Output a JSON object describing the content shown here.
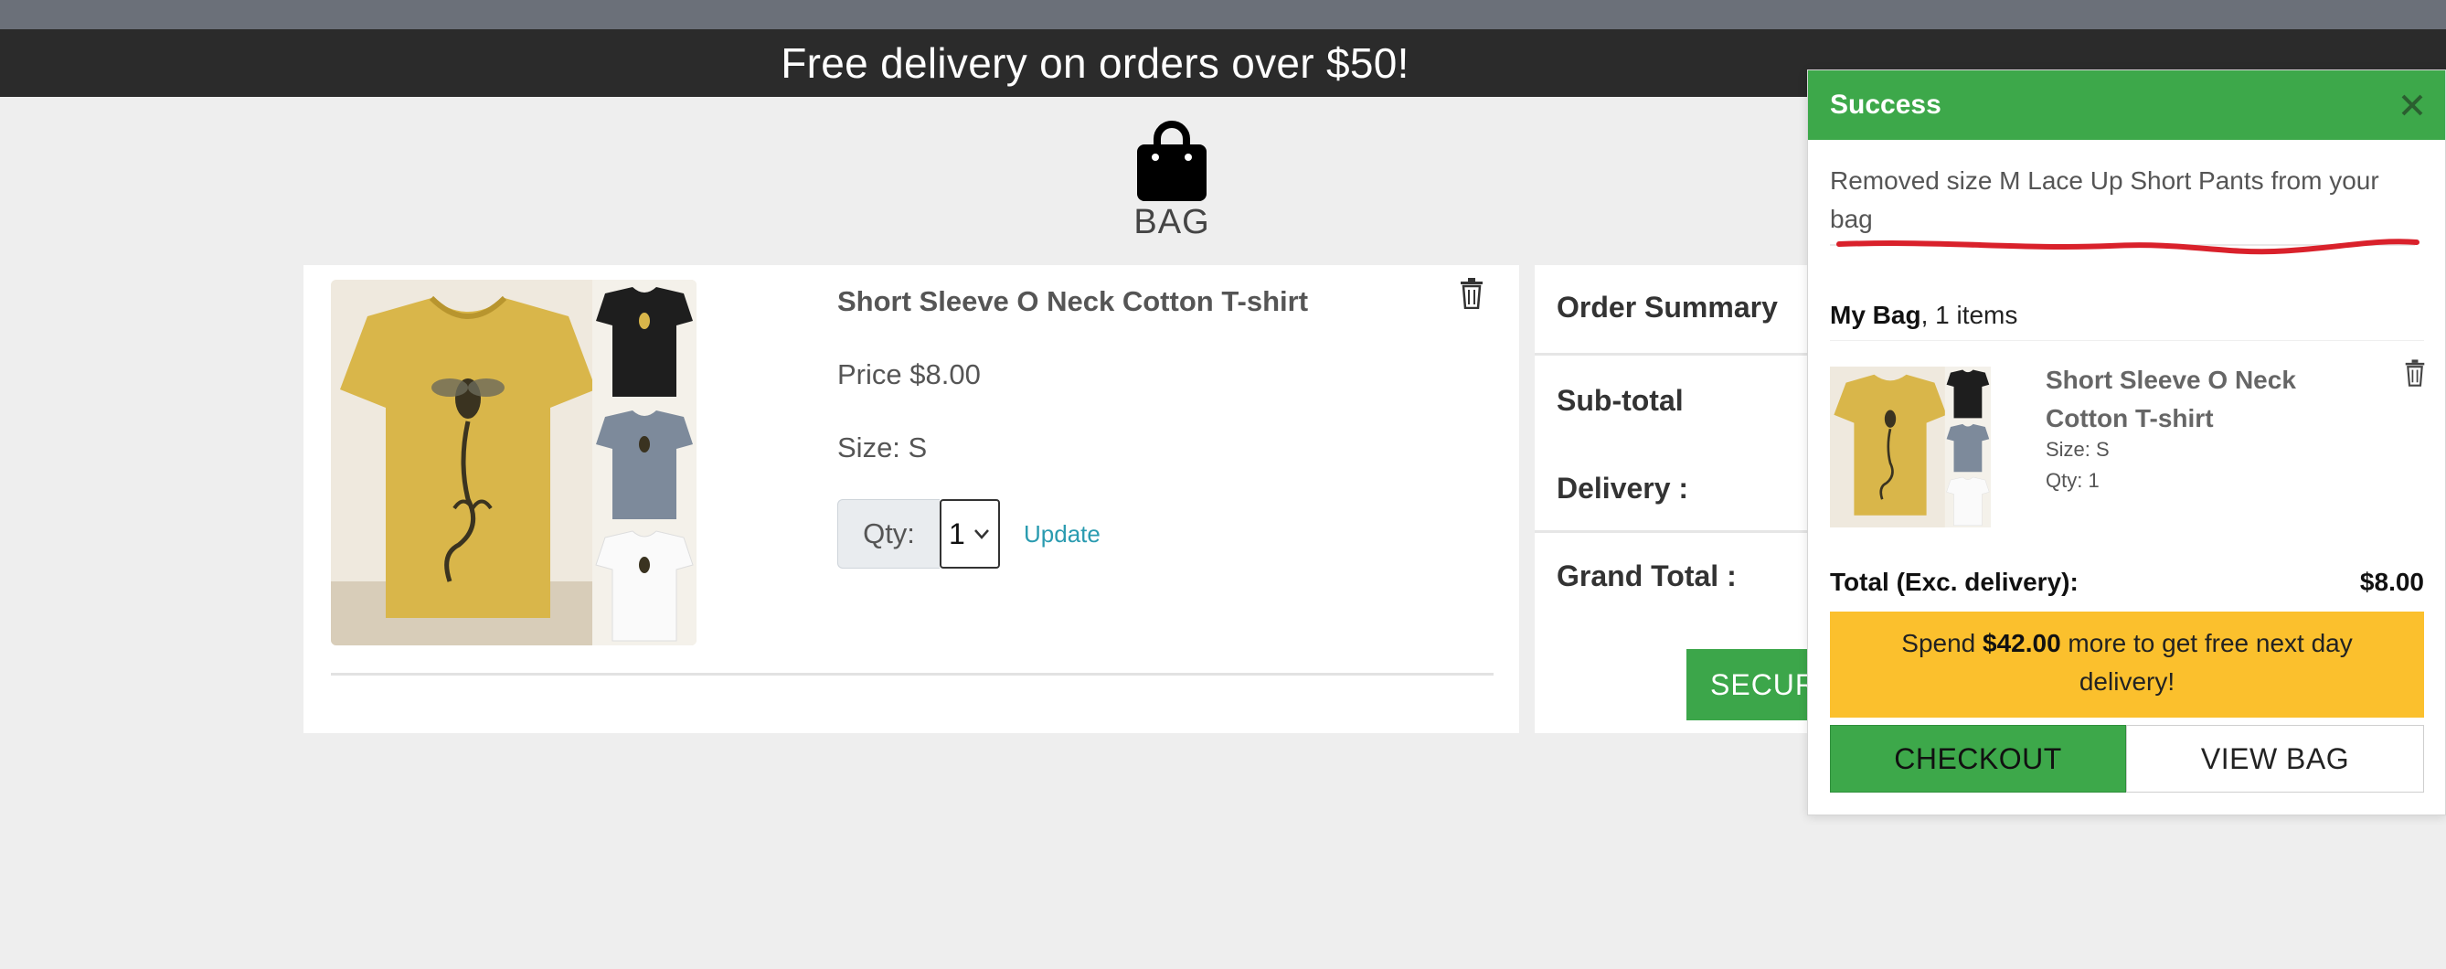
{
  "banner": {
    "text": "Free delivery on orders over $50!"
  },
  "page": {
    "title": "BAG"
  },
  "bag_item": {
    "name": "Short Sleeve O Neck Cotton T-shirt",
    "price": "Price $8.00",
    "size": "Size: S",
    "qty_label": "Qty:",
    "qty_value": "1",
    "update_label": "Update",
    "image_alt": "yellow t-shirt with bee print"
  },
  "summary": {
    "title": "Order Summary",
    "subtotal_label": "Sub-total",
    "delivery_label": "Delivery :",
    "grand_total_label": "Grand Total :",
    "secure_label": "SECUR"
  },
  "toast": {
    "title": "Success",
    "message": "Removed size M Lace Up Short Pants from your bag",
    "mybag_label": "My Bag",
    "mybag_count": ", 1 items",
    "item_name": "Short Sleeve O Neck Cotton T-shirt",
    "item_size": "Size: S",
    "item_qty": "Qty: 1",
    "total_label": "Total (Exc. delivery):",
    "total_value": "$8.00",
    "promo_prefix": "Spend ",
    "promo_amount": "$42.00",
    "promo_suffix": " more to get free next day delivery!",
    "checkout_label": "CHECKOUT",
    "view_bag_label": "VIEW BAG"
  },
  "colors": {
    "success_green": "#3da84a",
    "promo_yellow": "#fbc02d",
    "banner_dark": "#2b2b2b",
    "link_teal": "#2a9bb0",
    "annotation_red": "#d9212b"
  },
  "icons": [
    "shopping-bag-icon",
    "trash-icon",
    "close-icon",
    "chevron-down-icon"
  ]
}
